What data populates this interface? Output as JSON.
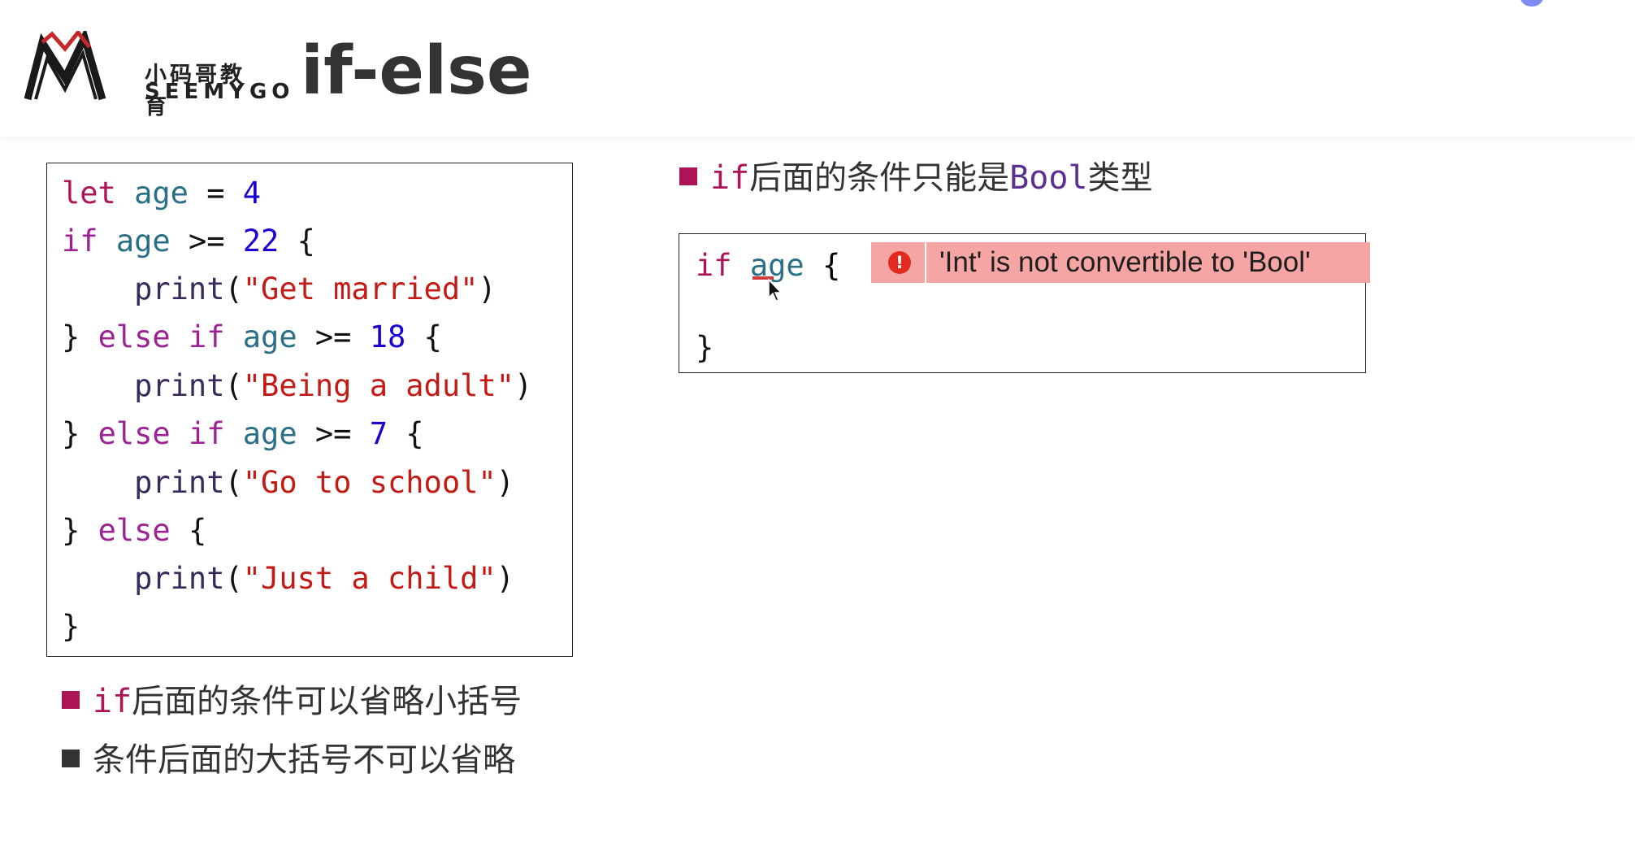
{
  "header": {
    "logo_cn": "小码哥教育",
    "logo_en": "SEEMYGO",
    "title": "if-else"
  },
  "colors": {
    "bullet_accent": "#ad1457",
    "bullet_dark": "#333333",
    "keyword": "#9b2393",
    "number": "#1c00cf",
    "string": "#c41a16",
    "error_bg": "#f6a5a5",
    "error_icon": "#e32a1e"
  },
  "code": {
    "lines": [
      {
        "t1": "let",
        "t2": " ",
        "t3": "age",
        "t4": " = ",
        "t5": "4",
        "t6": ""
      },
      {
        "t1": "if",
        "t2": " ",
        "t3": "age",
        "t4": " >= ",
        "t5": "22",
        "t6": " {"
      },
      {
        "p1": "    ",
        "p2": "print",
        "p3": "(",
        "p4": "\"Get married\"",
        "p5": ")"
      },
      {
        "t0": "} ",
        "t1": "else if",
        "t2": " ",
        "t3": "age",
        "t4": " >= ",
        "t5": "18",
        "t6": " {"
      },
      {
        "p1": "    ",
        "p2": "print",
        "p3": "(",
        "p4": "\"Being a adult\"",
        "p5": ")"
      },
      {
        "t0": "} ",
        "t1": "else if",
        "t2": " ",
        "t3": "age",
        "t4": " >= ",
        "t5": "7",
        "t6": " {"
      },
      {
        "p1": "    ",
        "p2": "print",
        "p3": "(",
        "p4": "\"Go to school\"",
        "p5": ")"
      },
      {
        "t0": "} ",
        "t1": "else",
        "t6": " {"
      },
      {
        "p1": "    ",
        "p2": "print",
        "p3": "(",
        "p4": "\"Just a child\"",
        "p5": ")"
      },
      {
        "t0": "}"
      }
    ]
  },
  "bullets": {
    "right": {
      "kw": "if",
      "text_a": "后面的条件只能是",
      "type": "Bool",
      "text_b": "类型"
    },
    "left1": {
      "kw": "if",
      "text": "后面的条件可以省略小括号"
    },
    "left2": {
      "text": "条件后面的大括号不可以省略"
    }
  },
  "error_example": {
    "kw": "if",
    "id": "age",
    "brace_open": " {",
    "brace_close": "}",
    "error_icon": "!",
    "error_icon_name": "error-icon",
    "error_message": "'Int' is not convertible to 'Bool'"
  }
}
